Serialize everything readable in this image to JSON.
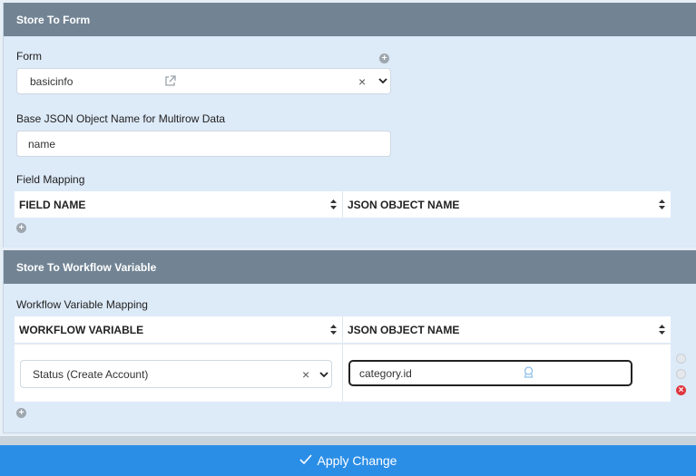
{
  "store_to_form": {
    "title": "Store To Form",
    "form_label": "Form",
    "form_value": "basicinfo",
    "base_json_label": "Base JSON Object Name for Multirow Data",
    "base_json_value": "name",
    "field_mapping_label": "Field Mapping",
    "columns": [
      "FIELD NAME",
      "JSON OBJECT NAME"
    ]
  },
  "store_to_workflow": {
    "title": "Store To Workflow Variable",
    "mapping_label": "Workflow Variable Mapping",
    "columns": [
      "WORKFLOW VARIABLE",
      "JSON OBJECT NAME"
    ],
    "rows": [
      {
        "variable": "Status (Create Account)",
        "json_object": "category.id"
      }
    ]
  },
  "apply_button": "Apply Change",
  "icons": {
    "open": "external-link-icon",
    "clear": "clear-x-icon",
    "dropdown": "chevron-down-icon",
    "add": "plus-circle-icon",
    "sort": "sort-arrows-icon",
    "up": "move-up-icon",
    "down": "move-down-icon",
    "remove": "remove-row-icon",
    "check": "check-icon"
  },
  "colors": {
    "header_bg": "#728494",
    "panel_bg": "#ddeaf8",
    "apply_bg": "#2b8ee6",
    "remove": "#e0363e"
  }
}
